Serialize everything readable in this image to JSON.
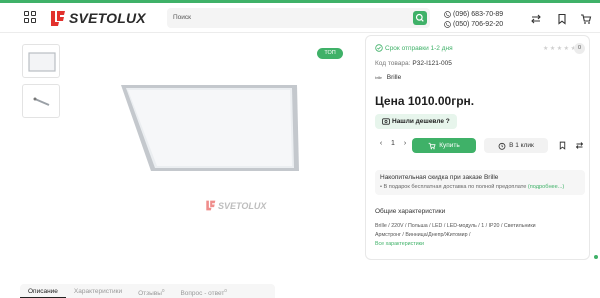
{
  "header": {
    "logo_text": "SVETOLUX",
    "search_placeholder": "Поиск",
    "phones": [
      "(096) 683-70-89",
      "(050) 706-92-20"
    ]
  },
  "gallery": {
    "badge": "ТОП",
    "watermark_text": "SVETOLUX"
  },
  "tabs": [
    {
      "label": "Описание",
      "count": ""
    },
    {
      "label": "Характеристики",
      "count": ""
    },
    {
      "label": "Отзывы",
      "count": "0"
    },
    {
      "label": "Вопрос - ответ",
      "count": "0"
    }
  ],
  "product": {
    "shipping": "Срок отправки 1-2 дня",
    "reviews_count": "0",
    "code_label": "Код товара:",
    "code_value": "P32-I121-005",
    "brand_logo_text": "brille",
    "brand": "Brille",
    "price": "Цена 1010.00грн.",
    "cheaper_label": "Нашли дешевле ?",
    "quantity": "1",
    "buy_label": "Купить",
    "one_click_label": "В 1 клик"
  },
  "discount": {
    "title": "Накопительная скидка при заказе Brille",
    "text": "• В подарок бесплатная доставка по полной предоплате",
    "link": "(подробнее...)"
  },
  "characteristics": {
    "title": "Общие характеристики",
    "line1": "Brille  /  220V  /  Польша  /  LED  /  LED-модуль  /  1  /  IP20  /  Светильники",
    "line2": "Армстронг  /  Винница/Днепр/Житомир  /",
    "all_link": "Все характеристики"
  },
  "colors": {
    "accent": "#3fb168",
    "logo_red": "#e2312d"
  }
}
